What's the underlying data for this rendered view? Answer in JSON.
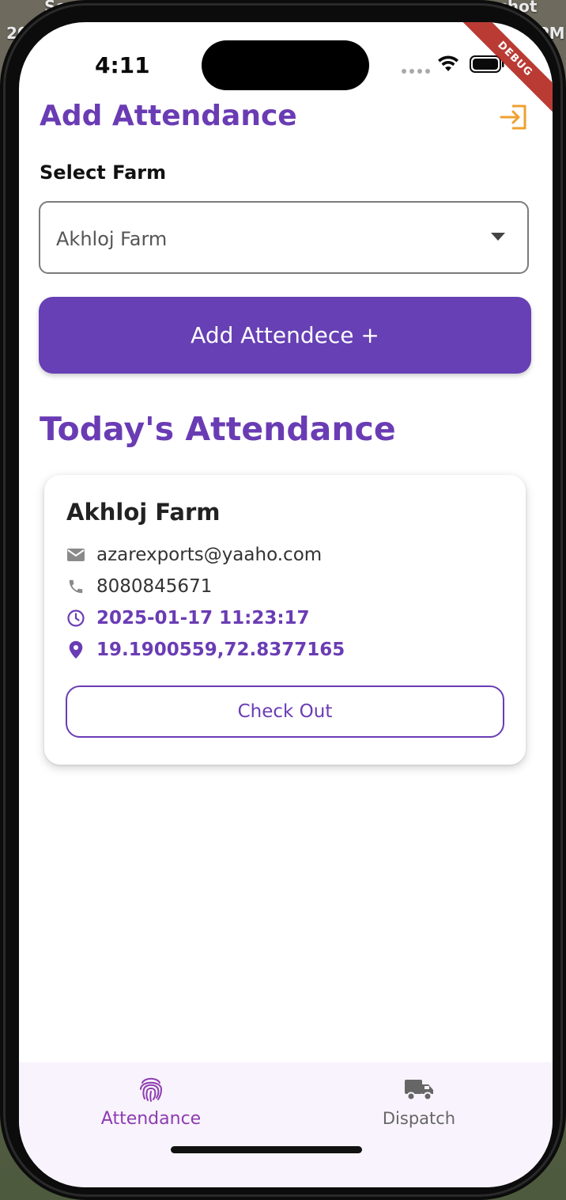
{
  "status_bar": {
    "time": "4:11",
    "debug_banner": "DEBUG"
  },
  "header": {
    "title": "Add Attendance",
    "logout_icon": "logout-icon"
  },
  "form": {
    "select_label": "Select Farm",
    "selected_farm": "Akhloj Farm",
    "add_button_label": "Add Attendece +"
  },
  "today": {
    "title": "Today's Attendance",
    "card": {
      "farm_name": "Akhloj Farm",
      "email": "azarexports@yaaho.com",
      "phone": "8080845671",
      "datetime": "2025-01-17 11:23:17",
      "location": "19.1900559,72.8377165",
      "checkout_label": "Check Out"
    }
  },
  "bottom_nav": {
    "items": [
      {
        "label": "Attendance",
        "icon": "fingerprint-icon",
        "active": true
      },
      {
        "label": "Dispatch",
        "icon": "truck-icon",
        "active": false
      }
    ]
  },
  "colors": {
    "accent": "#6A3CB4",
    "primary_button": "#6640B4",
    "logout_icon": "#F0A030",
    "active_nav": "#8E3BB0",
    "inactive_nav": "#666666"
  }
}
